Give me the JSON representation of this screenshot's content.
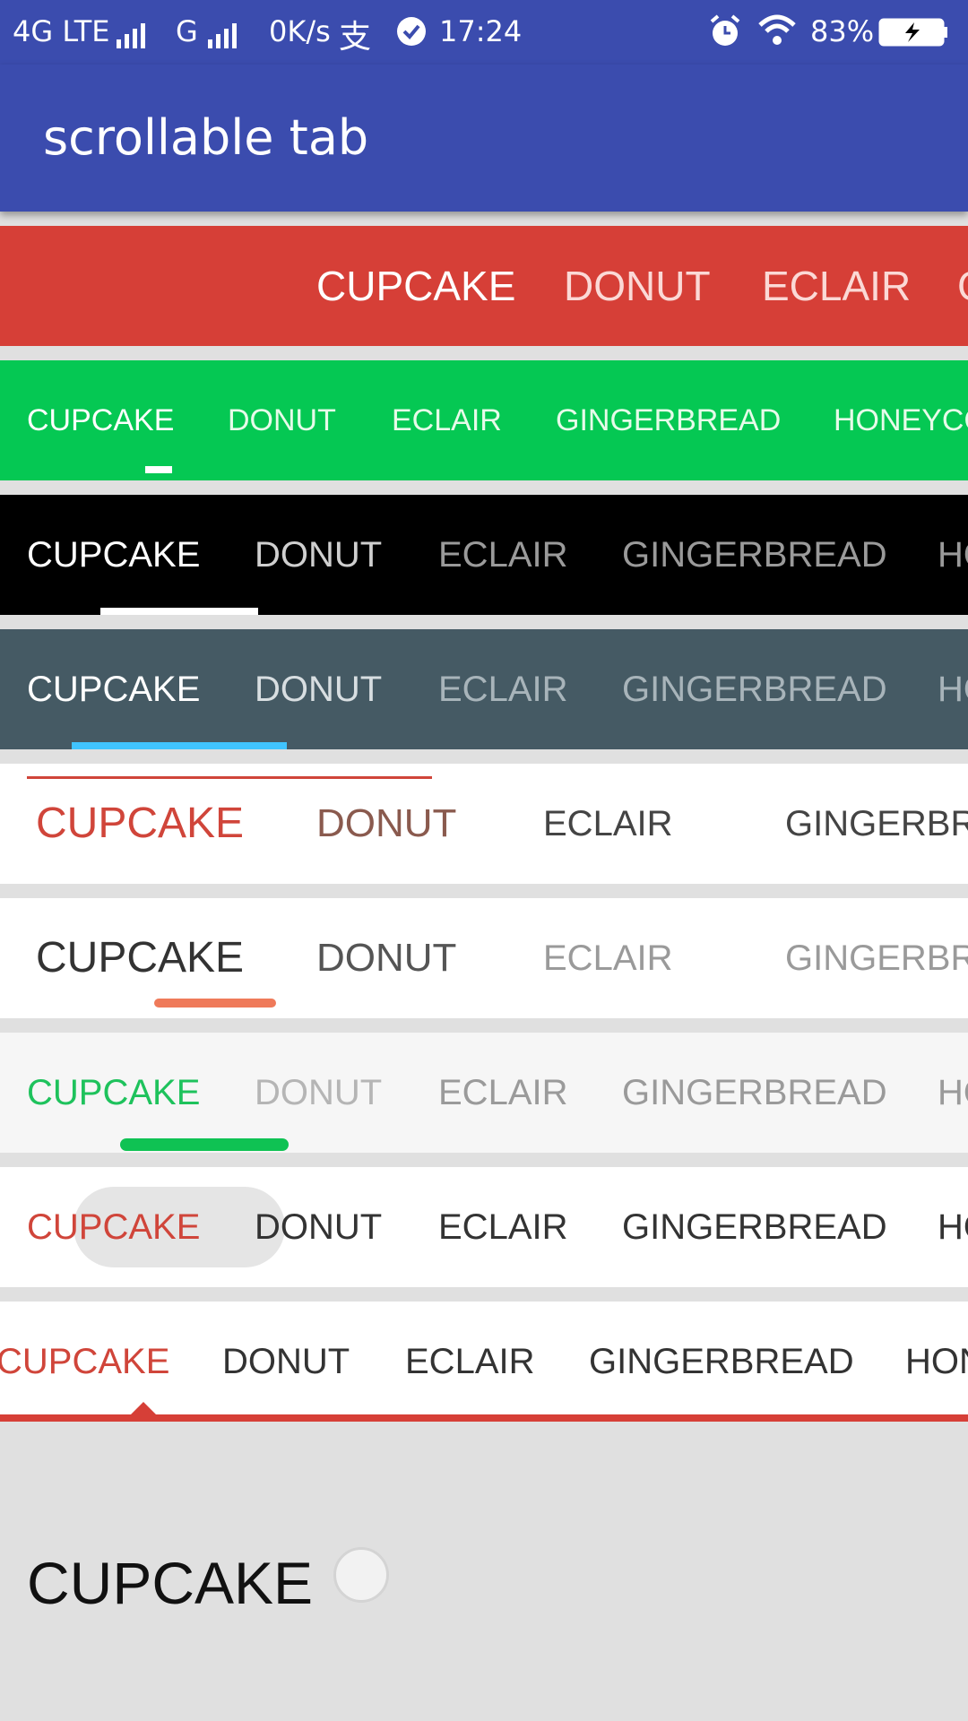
{
  "status_bar": {
    "network": "4G LTE",
    "network2": "G",
    "speed": "0K/s",
    "app_icon_char": "支",
    "time": "17:24",
    "battery": "83%",
    "icons": [
      "signal-icon",
      "alipay-icon",
      "check-circle-icon",
      "alarm-icon",
      "wifi-icon",
      "battery-icon"
    ]
  },
  "app_bar": {
    "title": "scrollable tab"
  },
  "tabs": {
    "row1": [
      "CUPCAKE",
      "DONUT",
      "ECLAIR",
      "GINGERBREAD"
    ],
    "row2": [
      "CUPCAKE",
      "DONUT",
      "ECLAIR",
      "GINGERBREAD",
      "HONEYCOMB"
    ],
    "row3": [
      "CUPCAKE",
      "DONUT",
      "ECLAIR",
      "GINGERBREAD",
      "HONEYCOMB"
    ],
    "row4": [
      "CUPCAKE",
      "DONUT",
      "ECLAIR",
      "GINGERBREAD",
      "HONEYCOMB"
    ],
    "row5": [
      "CUPCAKE",
      "DONUT",
      "ECLAIR",
      "GINGERBREAD"
    ],
    "row6": [
      "CUPCAKE",
      "DONUT",
      "ECLAIR",
      "GINGERBREAD"
    ],
    "row7": [
      "CUPCAKE",
      "DONUT",
      "ECLAIR",
      "GINGERBREAD",
      "HONEYCOMB"
    ],
    "row8": [
      "CUPCAKE",
      "DONUT",
      "ECLAIR",
      "GINGERBREAD",
      "HONEYCOMB"
    ],
    "row9": [
      "CUPCAKE",
      "DONUT",
      "ECLAIR",
      "GINGERBREAD",
      "HONEYCOMB"
    ]
  },
  "colors": {
    "primary": "#3b4cae",
    "row1_bg": "#d63f37",
    "row2_bg": "#05c853",
    "row3_bg": "#000000",
    "row4_bg": "#455a64",
    "row4_indicator": "#40c4ff",
    "accent_red": "#d0453a",
    "accent_green": "#0fc253"
  },
  "content": {
    "label": "CUPCAKE"
  }
}
